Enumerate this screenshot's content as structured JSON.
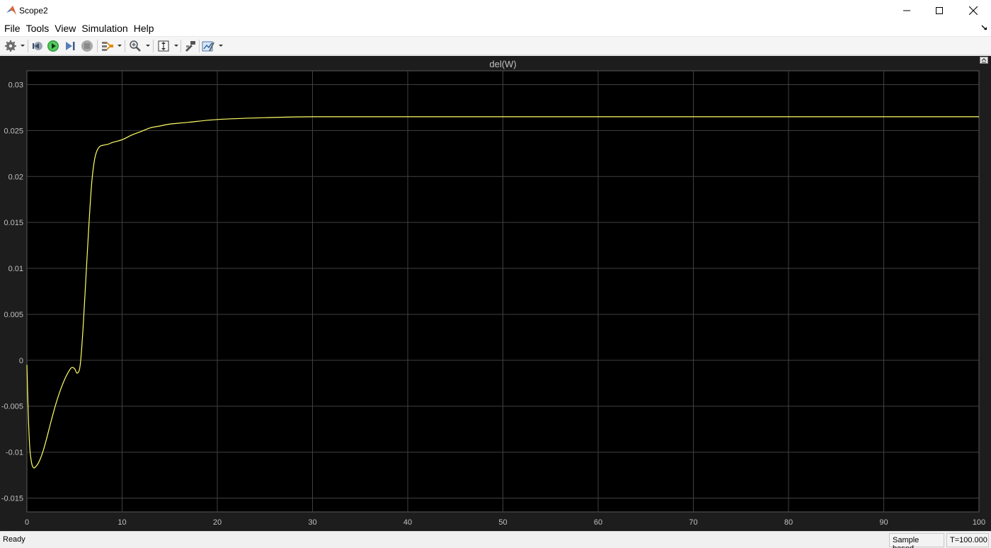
{
  "window": {
    "title": "Scope2",
    "controls": {
      "minimize": "—",
      "maximize": "☐",
      "close": "✕"
    }
  },
  "menu": {
    "items": [
      "File",
      "Tools",
      "View",
      "Simulation",
      "Help"
    ]
  },
  "toolbar": {
    "icons": [
      "gear-icon",
      "step-back-icon",
      "run-icon",
      "step-forward-icon",
      "stop-icon",
      "signal-selector-icon",
      "zoom-in-icon",
      "fit-axes-icon",
      "highlight-block-icon",
      "style-icon"
    ]
  },
  "colors": {
    "plot_background": "#000000",
    "figure_background": "#1d1d1d",
    "grid": "#404040",
    "axis_text": "#c0c0c0",
    "signal": "#ffff66"
  },
  "chart_data": {
    "type": "line",
    "title": "del(W)",
    "xlabel": "",
    "ylabel": "",
    "xlim": [
      0,
      100
    ],
    "ylim": [
      -0.0165,
      0.0315
    ],
    "xticks": [
      "0",
      "10",
      "20",
      "30",
      "40",
      "50",
      "60",
      "70",
      "80",
      "90",
      "100"
    ],
    "yticks": [
      "0.03",
      "0.025",
      "0.02",
      "0.015",
      "0.01",
      "0.005",
      "0",
      "-0.005",
      "-0.01",
      "-0.015"
    ],
    "grid": true,
    "series": [
      {
        "color": "#ffff66",
        "x": [
          0,
          0.15,
          0.3,
          0.5,
          0.7,
          0.9,
          1.2,
          1.6,
          2.0,
          2.5,
          3.0,
          3.5,
          4.0,
          4.4,
          4.7,
          5.0,
          5.3,
          5.6,
          5.9,
          6.2,
          6.5,
          6.8,
          7.1,
          7.4,
          7.7,
          8.0,
          8.5,
          9.0,
          10.0,
          11.0,
          12.0,
          13.0,
          14.0,
          15.0,
          17.0,
          20.0,
          25.0,
          30.0,
          40.0,
          50.0,
          60.0,
          70.0,
          80.0,
          90.0,
          100.0
        ],
        "y": [
          -0.0005,
          -0.006,
          -0.0095,
          -0.0112,
          -0.0117,
          -0.0116,
          -0.0112,
          -0.0102,
          -0.0088,
          -0.0068,
          -0.0049,
          -0.0033,
          -0.002,
          -0.0012,
          -0.0008,
          -0.0009,
          -0.0014,
          -0.0005,
          0.0035,
          0.009,
          0.0145,
          0.0192,
          0.0218,
          0.0229,
          0.0233,
          0.0234,
          0.0235,
          0.0237,
          0.024,
          0.0245,
          0.0249,
          0.0253,
          0.0255,
          0.0257,
          0.0259,
          0.0262,
          0.0264,
          0.0265,
          0.0265,
          0.0265,
          0.0265,
          0.0265,
          0.0265,
          0.0265,
          0.0265
        ]
      }
    ]
  },
  "status": {
    "ready": "Ready",
    "mode": "Sample based",
    "time": "T=100.000"
  }
}
